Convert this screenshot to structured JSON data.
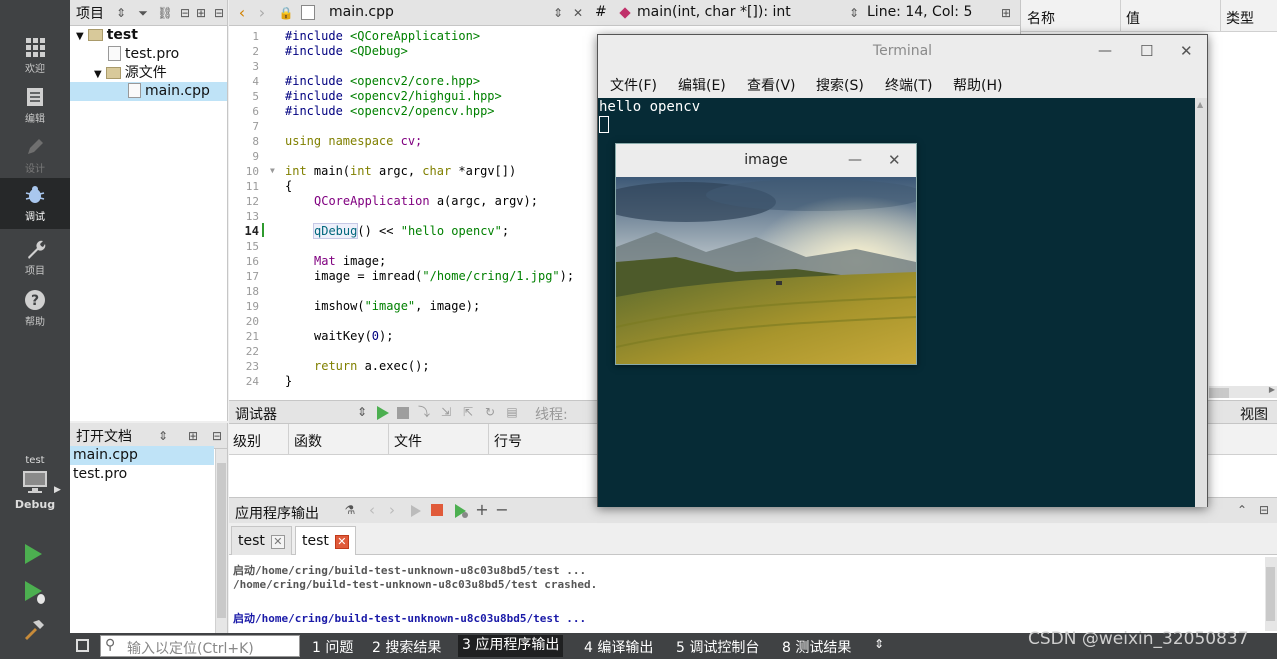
{
  "modebar": {
    "modes": [
      "欢迎",
      "编辑",
      "设计",
      "调试",
      "项目",
      "帮助"
    ],
    "target_project": "test",
    "target_config": "Debug"
  },
  "project_panel": {
    "title": "项目",
    "tree": {
      "root": "test",
      "pro_file": "test.pro",
      "folder": "源文件",
      "source": "main.cpp"
    }
  },
  "docs_panel": {
    "title": "打开文档",
    "files": [
      "main.cpp",
      "test.pro"
    ]
  },
  "editor_bar": {
    "file": "main.cpp",
    "symbol_hash": "#",
    "symbol": "main(int, char *[]): int",
    "position": "Line: 14, Col: 5"
  },
  "editor": {
    "line_numbers": [
      "1",
      "2",
      "3",
      "4",
      "5",
      "6",
      "7",
      "8",
      "9",
      "10",
      "11",
      "12",
      "13",
      "14",
      "15",
      "16",
      "17",
      "18",
      "19",
      "20",
      "21",
      "22",
      "23",
      "24"
    ],
    "current_line": "14",
    "code": {
      "l1_a": "#include ",
      "l1_b": "<QCoreApplication>",
      "l2_a": "#include ",
      "l2_b": "<QDebug>",
      "l4_a": "#include ",
      "l4_b": "<opencv2/core.hpp>",
      "l5_a": "#include ",
      "l5_b": "<opencv2/highgui.hpp>",
      "l6_a": "#include ",
      "l6_b": "<opencv2/opencv.hpp>",
      "l8_a": "using namespace ",
      "l8_b": "cv;",
      "l10_a": "int ",
      "l10_b": "main(",
      "l10_c": "int ",
      "l10_d": "argc, ",
      "l10_e": "char ",
      "l10_f": "*argv[])",
      "l11": "{",
      "l12_a": "QCoreApplication ",
      "l12_b": "a(argc, argv);",
      "l14_a": "qDebug",
      "l14_b": "() << ",
      "l14_c": "\"hello opencv\"",
      "l14_d": ";",
      "l16_a": "Mat ",
      "l16_b": "image;",
      "l17_a": "image = imread(",
      "l17_b": "\"/home/cring/1.jpg\"",
      "l17_c": ");",
      "l19_a": "imshow(",
      "l19_b": "\"image\"",
      "l19_c": ", image);",
      "l21_a": "waitKey(",
      "l21_b": "0",
      "l21_c": ");",
      "l23_a": "return ",
      "l23_b": "a.exec();",
      "l24": "}"
    }
  },
  "right_panel": {
    "columns": [
      "名称",
      "值",
      "类型"
    ],
    "view_label": "视图"
  },
  "debugger": {
    "title": "调试器",
    "thread_label": "线程:",
    "columns": [
      "级别",
      "函数",
      "文件",
      "行号"
    ]
  },
  "app_output": {
    "title": "应用程序输出",
    "tabs": [
      "test",
      "test"
    ],
    "lines": [
      "启动/home/cring/build-test-unknown-u8c03u8bd5/test ...",
      "/home/cring/build-test-unknown-u8c03u8bd5/test crashed.",
      "",
      "启动/home/cring/build-test-unknown-u8c03u8bd5/test ..."
    ]
  },
  "statusbar": {
    "locator_placeholder": "输入以定位(Ctrl+K)",
    "panes": [
      "1 问题",
      "2 搜索结果",
      "3 应用程序输出",
      "4 编译输出",
      "5 调试控制台",
      "8 测试结果"
    ],
    "watermark": "CSDN @weixin_32050837"
  },
  "terminal": {
    "title": "Terminal",
    "menu": [
      "文件(F)",
      "编辑(E)",
      "查看(V)",
      "搜索(S)",
      "终端(T)",
      "帮助(H)"
    ],
    "output": "hello opencv"
  },
  "image_window": {
    "title": "image"
  },
  "colors": {
    "sidebar": "#404244",
    "terminal_bg": "#062b36",
    "selection": "#bfe3f7",
    "stop_red": "#e05a3a",
    "run_green": "#4caf50"
  }
}
